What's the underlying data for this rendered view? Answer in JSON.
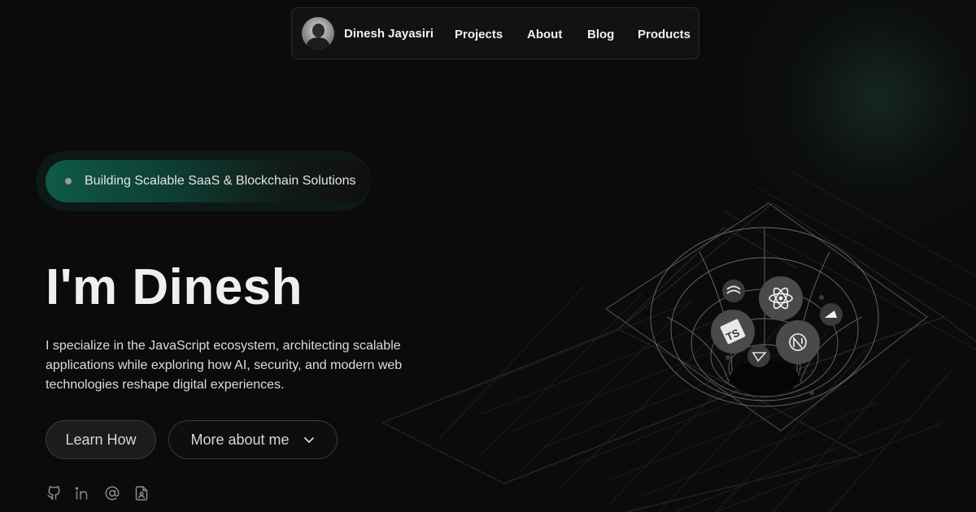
{
  "nav": {
    "name": "Dinesh Jayasiri",
    "links": [
      "Projects",
      "About",
      "Blog",
      "Products"
    ]
  },
  "hero": {
    "badge": "Building Scalable SaaS & Blockchain Solutions",
    "title": "I'm Dinesh",
    "description": "I specialize in the JavaScript ecosystem, architecting scalable applications while exploring how AI, security, and modern web technologies reshape digital experiences.",
    "learn_label": "Learn How",
    "more_label": "More about me"
  },
  "social_icons": [
    "github-icon",
    "linkedin-icon",
    "at-sign-icon",
    "resume-icon"
  ],
  "tech_icons": [
    "tailwind-icon",
    "react-icon",
    "typescript-icon",
    "nextjs-icon",
    "vite-icon",
    "vercel-icon"
  ],
  "colors": {
    "background": "#0b0b0b",
    "badge_green": "#0f5a47",
    "text": "#efefef"
  }
}
